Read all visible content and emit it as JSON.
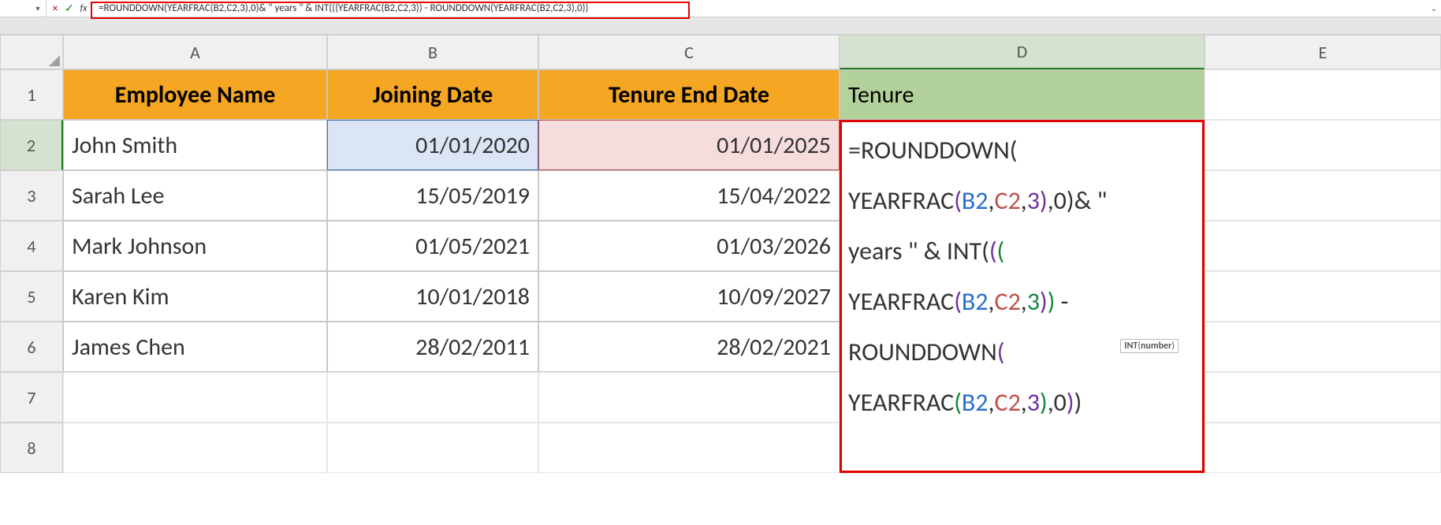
{
  "formula_bar": {
    "dropdown_glyph": "▾",
    "cancel_glyph": "×",
    "enter_glyph": "✓",
    "fx_label": "fx",
    "formula_text": "=ROUNDDOWN(YEARFRAC(B2,C2,3),0)& \" years \" & INT(((YEARFRAC(B2,C2,3)) - ROUNDDOWN(YEARFRAC(B2,C2,3),0))",
    "expand_glyph": "⌄"
  },
  "columns": [
    "A",
    "B",
    "C",
    "D",
    "E"
  ],
  "rows": [
    "1",
    "2",
    "3",
    "4",
    "5",
    "6",
    "7",
    "8"
  ],
  "headers": {
    "A": "Employee Name",
    "B": "Joining Date",
    "C": "Tenure End Date",
    "D": "Tenure"
  },
  "data": [
    {
      "name": "John Smith",
      "join": "01/01/2020",
      "end": "01/01/2025"
    },
    {
      "name": "Sarah Lee",
      "join": "15/05/2019",
      "end": "15/04/2022"
    },
    {
      "name": "Mark Johnson",
      "join": "01/05/2021",
      "end": "01/03/2026"
    },
    {
      "name": "Karen Kim",
      "join": "10/01/2018",
      "end": "10/09/2027"
    },
    {
      "name": "James Chen",
      "join": "28/02/2011",
      "end": "28/02/2021"
    }
  ],
  "big_formula_tokens": [
    {
      "t": "=ROUNDDOWN",
      "c": "p1"
    },
    {
      "t": "(",
      "c": "p1"
    },
    {
      "nl": 1
    },
    {
      "t": "YEARFRAC",
      "c": "p1"
    },
    {
      "t": "(",
      "c": "p2"
    },
    {
      "t": "B2",
      "c": "b2"
    },
    {
      "t": ",",
      "c": "p1"
    },
    {
      "t": "C2",
      "c": "c2"
    },
    {
      "t": ",",
      "c": "p1"
    },
    {
      "t": "3",
      "c": "3b"
    },
    {
      "t": ")",
      "c": "p2"
    },
    {
      "t": ",0",
      "c": "p1"
    },
    {
      "t": ")",
      "c": "p1"
    },
    {
      "t": "& \" ",
      "c": "p1"
    },
    {
      "nl": 1
    },
    {
      "t": "years \" & INT",
      "c": "p1"
    },
    {
      "t": "(",
      "c": "p1"
    },
    {
      "t": "(",
      "c": "p2"
    },
    {
      "t": "(",
      "c": "p3"
    },
    {
      "nl": 1
    },
    {
      "t": "YEARFRAC",
      "c": "p1"
    },
    {
      "t": "(",
      "c": "p2"
    },
    {
      "t": "B2",
      "c": "b2"
    },
    {
      "t": ",",
      "c": "p1"
    },
    {
      "t": "C2",
      "c": "c2"
    },
    {
      "t": ",",
      "c": "p1"
    },
    {
      "t": "3",
      "c": "3a"
    },
    {
      "t": ")",
      "c": "p2"
    },
    {
      "t": ")",
      "c": "p3"
    },
    {
      "t": " - ",
      "c": "p1"
    },
    {
      "nl": 1
    },
    {
      "t": "ROUNDDOWN",
      "c": "p1"
    },
    {
      "t": "(",
      "c": "p2"
    },
    {
      "nl": 1
    },
    {
      "t": "YEARFRAC",
      "c": "p1"
    },
    {
      "t": "(",
      "c": "p3"
    },
    {
      "t": "B2",
      "c": "b2"
    },
    {
      "t": ",",
      "c": "p1"
    },
    {
      "t": "C2",
      "c": "c2"
    },
    {
      "t": ",",
      "c": "p1"
    },
    {
      "t": "3",
      "c": "3b"
    },
    {
      "t": ")",
      "c": "p3"
    },
    {
      "t": ",0",
      "c": "p1"
    },
    {
      "t": ")",
      "c": "p2"
    },
    {
      "t": ")",
      "c": "p1"
    }
  ],
  "tooltip": {
    "fn": "INT",
    "arg": "number"
  },
  "active_cell": "D2"
}
